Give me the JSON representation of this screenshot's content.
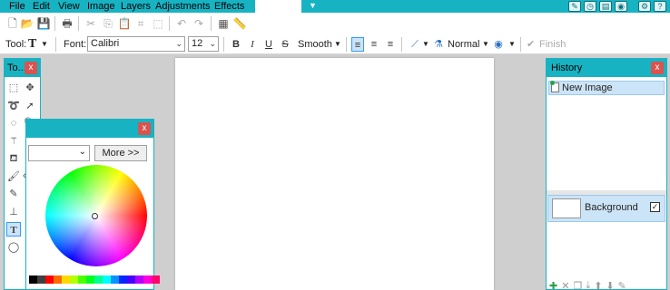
{
  "menu": {
    "items": [
      "File",
      "Edit",
      "View",
      "Image",
      "Layers",
      "Adjustments",
      "Effects"
    ]
  },
  "toolbar": {
    "tool_label": "Tool:",
    "tool_icon": "text-tool-icon",
    "font_label": "Font:",
    "font_value": "Calibri",
    "size_value": "12",
    "bold": "B",
    "italic": "I",
    "underline": "U",
    "strikethrough": "S",
    "antialias": "Smooth",
    "blend": "Normal",
    "finish": "Finish"
  },
  "tools_panel": {
    "title": "To...",
    "close": "x"
  },
  "colors_panel": {
    "more_label": "More >>",
    "close": "x",
    "palette": [
      "#000000",
      "#404040",
      "#ff0000",
      "#ff6a00",
      "#ffd800",
      "#b6ff00",
      "#4cff00",
      "#00ff21",
      "#00ff90",
      "#00ffff",
      "#0094ff",
      "#0026ff",
      "#4800ff",
      "#b200ff",
      "#ff00dc",
      "#ff006e"
    ]
  },
  "history_panel": {
    "title": "History",
    "close": "x",
    "items": [
      "New Image"
    ]
  },
  "layers_panel": {
    "layers": [
      {
        "name": "Background",
        "visible": true
      }
    ]
  },
  "colors": {
    "accent": "#18b3c3",
    "selection": "#cce4f7"
  }
}
